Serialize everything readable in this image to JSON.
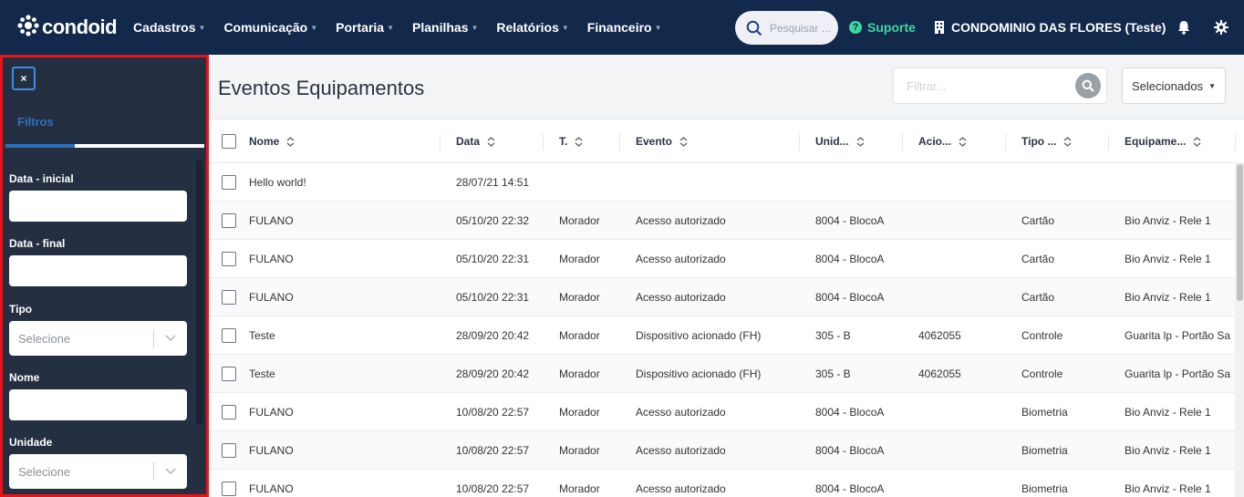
{
  "app": {
    "logo_text": "condoid",
    "nav": [
      "Cadastros",
      "Comunicação",
      "Portaria",
      "Planilhas",
      "Relatórios",
      "Financeiro"
    ],
    "search_placeholder": "Pesquisar ...",
    "support_label": "Suporte",
    "condo_name": "CONDOMINIO DAS FLORES (Teste)"
  },
  "sidebar": {
    "close_label": "×",
    "tab_label": "Filtros",
    "fields": {
      "date_start_label": "Data - inicial",
      "date_end_label": "Data - final",
      "type_label": "Tipo",
      "type_placeholder": "Selecione",
      "name_label": "Nome",
      "unit_label": "Unidade",
      "unit_placeholder": "Selecione"
    }
  },
  "main": {
    "title": "Eventos Equipamentos",
    "filter_placeholder": "Filtrar...",
    "selected_label": "Selecionados"
  },
  "table": {
    "columns": [
      "Nome",
      "Data",
      "T.",
      "Evento",
      "Unid...",
      "Acio...",
      "Tipo ...",
      "Equipame..."
    ],
    "rows": [
      [
        "Hello world!",
        "28/07/21 14:51",
        "",
        "",
        "",
        "",
        "",
        ""
      ],
      [
        "FULANO",
        "05/10/20 22:32",
        "Morador",
        "Acesso autorizado",
        "8004 - BlocoA",
        "",
        "Cartão",
        "Bio Anviz - Rele 1"
      ],
      [
        "FULANO",
        "05/10/20 22:31",
        "Morador",
        "Acesso autorizado",
        "8004 - BlocoA",
        "",
        "Cartão",
        "Bio Anviz - Rele 1"
      ],
      [
        "FULANO",
        "05/10/20 22:31",
        "Morador",
        "Acesso autorizado",
        "8004 - BlocoA",
        "",
        "Cartão",
        "Bio Anviz - Rele 1"
      ],
      [
        "Teste",
        "28/09/20 20:42",
        "Morador",
        "Dispositivo acionado (FH)",
        "305 - B",
        "4062055",
        "Controle",
        "Guarita lp - Portão Sa"
      ],
      [
        "Teste",
        "28/09/20 20:42",
        "Morador",
        "Dispositivo acionado (FH)",
        "305 - B",
        "4062055",
        "Controle",
        "Guarita lp - Portão Sa"
      ],
      [
        "FULANO",
        "10/08/20 22:57",
        "Morador",
        "Acesso autorizado",
        "8004 - BlocoA",
        "",
        "Biometria",
        "Bio Anviz - Rele 1"
      ],
      [
        "FULANO",
        "10/08/20 22:57",
        "Morador",
        "Acesso autorizado",
        "8004 - BlocoA",
        "",
        "Biometria",
        "Bio Anviz - Rele 1"
      ],
      [
        "FULANO",
        "10/08/20 22:57",
        "Morador",
        "Acesso autorizado",
        "8004 - BlocoA",
        "",
        "Biometria",
        "Bio Anviz - Rele 1"
      ]
    ]
  },
  "colors": {
    "topbar": "#13294b",
    "sidebar": "#243042",
    "highlight_border": "#e8141c",
    "accent_blue": "#2f6fba",
    "support_green": "#3fd6a0"
  }
}
